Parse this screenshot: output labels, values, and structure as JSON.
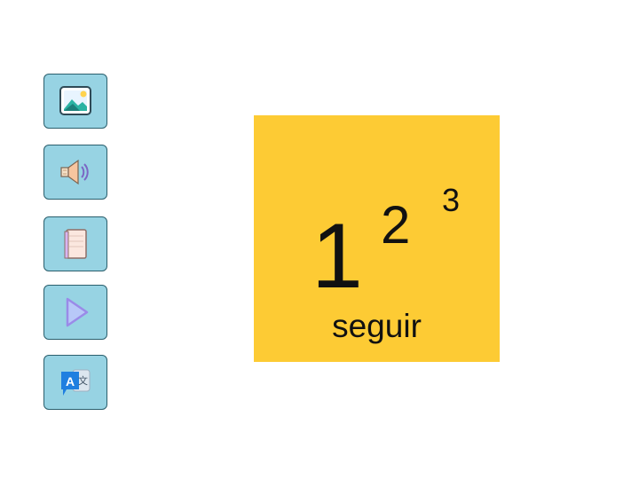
{
  "sidebar": {
    "buttons": [
      {
        "icon": "image-icon"
      },
      {
        "icon": "speaker-icon"
      },
      {
        "icon": "book-icon"
      },
      {
        "icon": "play-icon"
      },
      {
        "icon": "translate-icon"
      }
    ],
    "translate_glyphs": {
      "latin": "A",
      "chinese": "文"
    }
  },
  "card": {
    "digits": [
      "1",
      "2",
      "3"
    ],
    "word": "seguir"
  },
  "colors": {
    "button_bg": "#97d3e3",
    "button_border": "#2b5f6d",
    "card_bg": "#fdcb34",
    "text": "#111111",
    "play_icon": "#9a8ae8",
    "translate_blue": "#1f7fe0"
  }
}
